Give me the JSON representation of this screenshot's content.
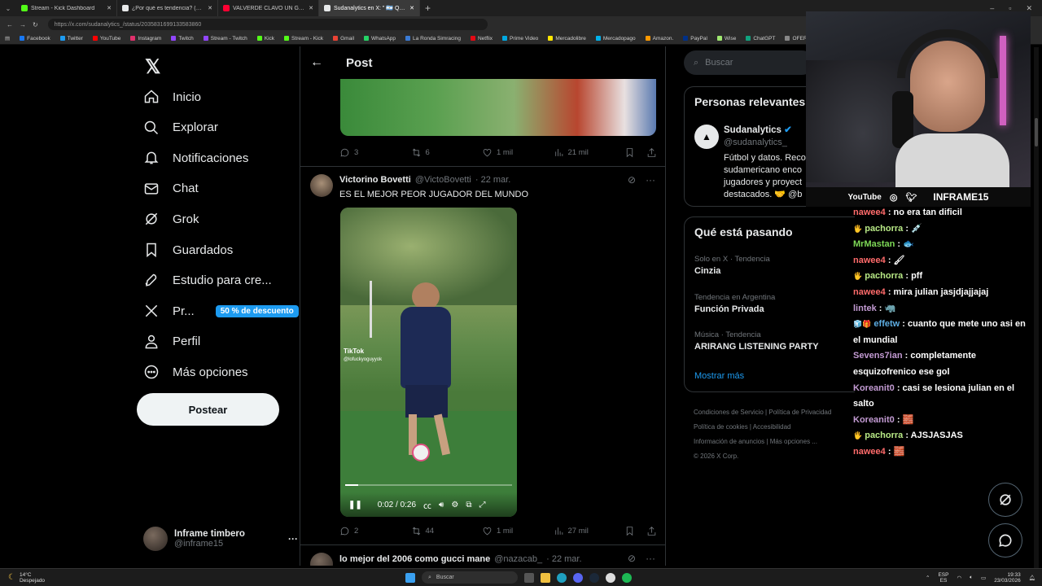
{
  "browser": {
    "tabs": [
      {
        "label": "Stream - Kick Dashboard",
        "color": "#53fc18",
        "active": false
      },
      {
        "label": "¿Por qué es tendencia? (@porque",
        "color": "#e7e9ea",
        "active": false
      },
      {
        "label": "VALVERDE CLAVÓ UN GOLAZO D",
        "color": "#ff0033",
        "active": false
      },
      {
        "label": "Sudanalytics en X: \" 🇦🇷 QUÉ",
        "color": "#e7e9ea",
        "active": true
      }
    ],
    "url": "https://x.com/sudanalytics_/status/2035831699133583860",
    "bookmarks": [
      {
        "label": "Facebook",
        "color": "#1877f2"
      },
      {
        "label": "Twitter",
        "color": "#1d9bf0"
      },
      {
        "label": "YouTube",
        "color": "#ff0000"
      },
      {
        "label": "Instagram",
        "color": "#e1306c"
      },
      {
        "label": "Twitch",
        "color": "#9146ff"
      },
      {
        "label": "Stream - Twitch",
        "color": "#9146ff"
      },
      {
        "label": "Kick",
        "color": "#53fc18"
      },
      {
        "label": "Stream - Kick",
        "color": "#53fc18"
      },
      {
        "label": "Gmail",
        "color": "#ea4335"
      },
      {
        "label": "WhatsApp",
        "color": "#25d366"
      },
      {
        "label": "La Ronda Simracing",
        "color": "#3a7bd5"
      },
      {
        "label": "Netflix",
        "color": "#e50914"
      },
      {
        "label": "Prime Video",
        "color": "#00a8e1"
      },
      {
        "label": "Mercadolibre",
        "color": "#ffe600"
      },
      {
        "label": "Mercadopago",
        "color": "#00b1ea"
      },
      {
        "label": "Amazon.",
        "color": "#ff9900"
      },
      {
        "label": "PayPal",
        "color": "#003087"
      },
      {
        "label": "Wise",
        "color": "#9fe870"
      },
      {
        "label": "ChatGPT",
        "color": "#10a37f"
      },
      {
        "label": "OFERTAS RIKY S",
        "color": "#888888"
      }
    ]
  },
  "nav": {
    "items": [
      {
        "label": "Inicio",
        "icon": "home-icon"
      },
      {
        "label": "Explorar",
        "icon": "search-icon"
      },
      {
        "label": "Notificaciones",
        "icon": "bell-icon"
      },
      {
        "label": "Chat",
        "icon": "mail-icon"
      },
      {
        "label": "Grok",
        "icon": "grok-icon"
      },
      {
        "label": "Guardados",
        "icon": "bookmark-icon"
      },
      {
        "label": "Estudio para cre...",
        "icon": "rocket-icon"
      },
      {
        "label": "Pr...",
        "icon": "x-logo-icon"
      },
      {
        "label": "Perfil",
        "icon": "person-icon"
      },
      {
        "label": "Más opciones",
        "icon": "more-circle-icon"
      }
    ],
    "promo_badge": "50 % de descuento",
    "post_button": "Postear",
    "profile": {
      "name": "Inframe timbero",
      "handle": "@inframe15",
      "more": "···"
    }
  },
  "center": {
    "header_title": "Post",
    "first_post_actions": {
      "replies": "3",
      "reposts": "6",
      "likes": "1 mil",
      "views": "21 mil"
    },
    "reply": {
      "name": "Victorino Bovetti",
      "handle": "@VictoBovetti",
      "date": "· 22 mar.",
      "text": "ES EL MEJOR PEOR JUGADOR DEL MUNDO",
      "video_time": "0:02 / 0:26",
      "video_progress": 0.08,
      "tiktok_watermark": "TikTok",
      "tiktok_user": "@lofuckyoguyyok",
      "actions": {
        "replies": "2",
        "reposts": "44",
        "likes": "1 mil",
        "views": "27 mil"
      }
    },
    "next_reply": {
      "name": "lo mejor del 2006 como gucci mane",
      "handle": "@nazacab_",
      "date": "· 22 mar."
    }
  },
  "right": {
    "search_placeholder": "Buscar",
    "relevant": {
      "title": "Personas relevantes",
      "name": "Sudanalytics",
      "handle": "@sudanalytics_",
      "bio": [
        "Fútbol y datos. Reco",
        "sudamericano enco",
        "jugadores y proyect",
        "destacados. 🤝 @b"
      ]
    },
    "trends": {
      "title": "Qué está pasando",
      "items": [
        {
          "meta": "Solo en X · Tendencia",
          "name": "Cinzia"
        },
        {
          "meta": "Tendencia en Argentina",
          "name": "Función Privada"
        },
        {
          "meta": "Música · Tendencia",
          "name": "ARIRANG LISTENING PARTY"
        }
      ],
      "show_more": "Mostrar más"
    },
    "footer": [
      "Condiciones de Servicio",
      "Política de Privacidad",
      "Política de cookies",
      "Accesibilidad",
      "Información de anuncios",
      "Más opciones ...",
      "© 2026 X Corp."
    ]
  },
  "stream": {
    "socials": "YouTube",
    "brand": "INFRAME15",
    "chat": [
      {
        "user": "nawee4",
        "color": "#ff6b6b",
        "text": ": no era tan dificil",
        "badge": ""
      },
      {
        "user": "pachorra",
        "color": "#b8e986",
        "text": ": 💉",
        "badge": "🖐"
      },
      {
        "user": "MrMastan",
        "color": "#7ed957",
        "text": ": 🐟",
        "badge": ""
      },
      {
        "user": "nawee4",
        "color": "#ff6b6b",
        "text": ": 🖌",
        "badge": ""
      },
      {
        "user": "pachorra",
        "color": "#b8e986",
        "text": ": pff",
        "badge": "🖐"
      },
      {
        "user": "nawee4",
        "color": "#ff6b6b",
        "text": ": mira julian jasjdjajjajaj",
        "badge": ""
      },
      {
        "user": "lintek",
        "color": "#c39bd3",
        "text": ": 🦏",
        "badge": ""
      },
      {
        "user": "effetw",
        "color": "#5dade2",
        "text": ": cuanto que mete uno asi en el mundial",
        "badge": "🧊🎁"
      },
      {
        "user": "Sevens7ian",
        "color": "#c39bd3",
        "text": ": completamente esquizofrenico ese gol",
        "badge": ""
      },
      {
        "user": "Koreanit0",
        "color": "#c39bd3",
        "text": ": casi se lesiona julian en el salto",
        "badge": ""
      },
      {
        "user": "Koreanit0",
        "color": "#c39bd3",
        "text": ": 🧱",
        "badge": ""
      },
      {
        "user": "pachorra",
        "color": "#b8e986",
        "text": ": AJSJASJAS",
        "badge": "🖐"
      },
      {
        "user": "nawee4",
        "color": "#ff6b6b",
        "text": ": 🧱",
        "badge": ""
      }
    ]
  },
  "taskbar": {
    "weather_temp": "14°C",
    "weather_desc": "Despejado",
    "search": "Buscar",
    "lang_top": "ESP",
    "lang_bottom": "ES",
    "time": "19:33",
    "date": "23/03/2026"
  }
}
